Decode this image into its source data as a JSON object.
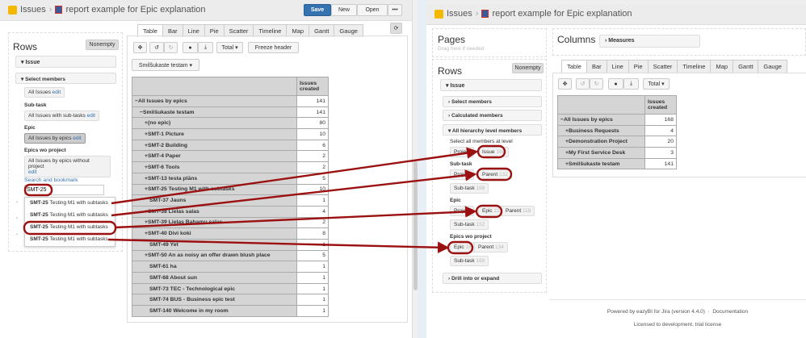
{
  "left": {
    "breadcrumb": {
      "root": "Issues",
      "report": "report example for Epic explanation"
    },
    "actions": {
      "save": "Save",
      "new": "New",
      "open": "Open",
      "more": "•••"
    },
    "rows": {
      "title": "Rows",
      "nonempty": "Nonempty",
      "dimension": "Issue",
      "select_members": "Select members",
      "hierarchies": [
        {
          "label": "",
          "value": "All Issues",
          "edit": "edit"
        },
        {
          "label": "Sub-task",
          "value": "All Issues with sub-tasks",
          "edit": "edit"
        },
        {
          "label": "Epic",
          "value": "All Issues by epics",
          "edit": "edit"
        },
        {
          "label": "Epics wo project",
          "value": "All Issues by epics without project",
          "edit": "edit"
        }
      ],
      "search_label": "Search and bookmark",
      "search_value": "SMT-25",
      "results": [
        {
          "key": "SMT-25",
          "text": "Testing M1 with subtasks"
        },
        {
          "key": "SMT-25",
          "text": "Testing M1 with subtasks"
        },
        {
          "key": "SMT-25",
          "text": "Testing M1 with subtasks"
        },
        {
          "key": "SMT-25",
          "text": "Testing M1 with subtasks"
        }
      ]
    },
    "tabs": [
      "Table",
      "Bar",
      "Line",
      "Pie",
      "Scatter",
      "Timeline",
      "Map",
      "Gantt",
      "Gauge"
    ],
    "toolbar": {
      "total": "Total ▾",
      "freeze": "Freeze header"
    },
    "page_filter": "Smilšukaste testam ▾",
    "table": {
      "header": "Issues created",
      "rows": [
        {
          "l": "−All Issues by epics",
          "v": "141",
          "i": 0
        },
        {
          "l": "−Smilšukaste testam",
          "v": "141",
          "i": 1
        },
        {
          "l": "+(no epic)",
          "v": "80",
          "i": 2
        },
        {
          "l": "+SMT-1 Picture",
          "v": "10",
          "i": 2
        },
        {
          "l": "+SMT-2 Building",
          "v": "6",
          "i": 2
        },
        {
          "l": "+SMT-4 Paper",
          "v": "2",
          "i": 2
        },
        {
          "l": "+SMT-6 Tools",
          "v": "2",
          "i": 2
        },
        {
          "l": "+SMT-13 testa plāns",
          "v": "5",
          "i": 2
        },
        {
          "l": "+SMT-25 Testing M1 with subtasks",
          "v": "10",
          "i": 2
        },
        {
          "l": "SMT-37 Jauns",
          "v": "1",
          "i": 3
        },
        {
          "l": "+SMT-38 Lielas salas",
          "v": "4",
          "i": 2
        },
        {
          "l": "+SMT-39 Lielas Bahamu salas",
          "v": "2",
          "i": 2
        },
        {
          "l": "+SMT-40 Divi koki",
          "v": "8",
          "i": 2
        },
        {
          "l": "SMT-49 Yet",
          "v": "1",
          "i": 3
        },
        {
          "l": "+SMT-50 An as noisy an offer drawn blush place",
          "v": "5",
          "i": 2
        },
        {
          "l": "SMT-61 ha",
          "v": "1",
          "i": 3
        },
        {
          "l": "SMT-68 About sun",
          "v": "1",
          "i": 3
        },
        {
          "l": "SMT-73 TEC - Technological epic",
          "v": "1",
          "i": 3
        },
        {
          "l": "SMT-74 BUS - Business epic test",
          "v": "1",
          "i": 3
        },
        {
          "l": "SMT-140 Welcome in my room",
          "v": "1",
          "i": 3
        }
      ]
    }
  },
  "right": {
    "breadcrumb": {
      "root": "Issues",
      "report": "report example for Epic explanation"
    },
    "pages": {
      "title": "Pages",
      "hint": "Drag here if needed"
    },
    "columns": {
      "title": "Columns",
      "measures": "Measures"
    },
    "rows": {
      "title": "Rows",
      "nonempty": "Nonempty",
      "dimension": "Issue",
      "select_members": "Select members",
      "calculated": "Calculated members",
      "all_levels": "All hierarchy level members",
      "select_all": "Select all members at level",
      "drill": "Drill into or expand",
      "groups": [
        {
          "label": "",
          "members": [
            {
              "n": "Project",
              "c": ""
            },
            {
              "n": "Issue",
              "c": "168"
            }
          ]
        },
        {
          "label": "Sub-task",
          "members": [
            {
              "n": "Project",
              "c": ""
            },
            {
              "n": "Parent",
              "c": "132"
            },
            {
              "n": "Sub-task",
              "c": "168"
            }
          ]
        },
        {
          "label": "Epic",
          "members": [
            {
              "n": "Project",
              "c": ""
            },
            {
              "n": "Epic",
              "c": "22"
            },
            {
              "n": "Parent",
              "c": "118"
            },
            {
              "n": "Sub-task",
              "c": "152"
            }
          ]
        },
        {
          "label": "Epics wo project",
          "members": [
            {
              "n": "Epic",
              "c": "18"
            },
            {
              "n": "Parent",
              "c": "134"
            },
            {
              "n": "Sub-task",
              "c": "168"
            }
          ]
        }
      ]
    },
    "tabs": [
      "Table",
      "Bar",
      "Line",
      "Pie",
      "Scatter",
      "Timeline",
      "Map",
      "Gantt",
      "Gauge"
    ],
    "toolbar": {
      "total": "Total ▾"
    },
    "table": {
      "header": "Issues created",
      "rows": [
        {
          "l": "−All Issues by epics",
          "v": "168",
          "i": 0
        },
        {
          "l": "+Business Requests",
          "v": "4",
          "i": 1
        },
        {
          "l": "+Demonstration Project",
          "v": "20",
          "i": 1
        },
        {
          "l": "+My First Service Desk",
          "v": "3",
          "i": 1
        },
        {
          "l": "+Smilšukaste testam",
          "v": "141",
          "i": 1
        }
      ]
    },
    "footer": {
      "powered": "Powered by eazyBI for Jira (version 4.4.0)",
      "sep": "·",
      "docs": "Documentation",
      "license": "Licensed to development, trial license"
    }
  },
  "colors": {
    "annotation": "#9b1010",
    "save": "#3572b0"
  }
}
